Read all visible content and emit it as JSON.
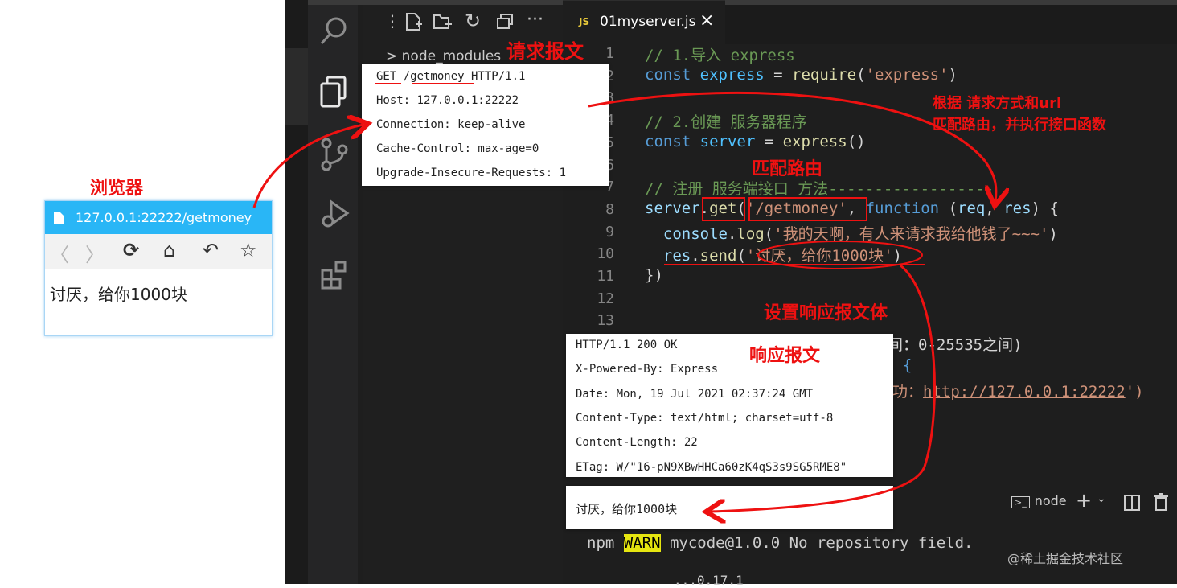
{
  "editor": {
    "tab_icon": "JS",
    "tab_filename": "01myserver.js",
    "tab_close": "×",
    "explorer_item": "> node_modules",
    "code_lines": [
      {
        "n": "1",
        "tokens": [
          [
            "cmt",
            "// 1.导入 express"
          ]
        ]
      },
      {
        "n": "2",
        "tokens": [
          [
            "kw",
            "const "
          ],
          [
            "var",
            "express"
          ],
          [
            "pl",
            " = "
          ],
          [
            "fn",
            "require"
          ],
          [
            "pl",
            "("
          ],
          [
            "str",
            "'express'"
          ],
          [
            "pl",
            ")"
          ]
        ]
      },
      {
        "n": "3",
        "tokens": []
      },
      {
        "n": "4",
        "tokens": [
          [
            "cmt",
            "// 2.创建 服务器程序"
          ]
        ]
      },
      {
        "n": "5",
        "tokens": [
          [
            "kw",
            "const "
          ],
          [
            "var",
            "server"
          ],
          [
            "pl",
            " = "
          ],
          [
            "fn",
            "express"
          ],
          [
            "pl",
            "()"
          ]
        ]
      },
      {
        "n": "6",
        "tokens": []
      },
      {
        "n": "7",
        "tokens": [
          [
            "cmt",
            "// 注册 服务端接口 方法------------------"
          ]
        ]
      },
      {
        "n": "8",
        "tokens": [
          [
            "par",
            "server"
          ],
          [
            "pl",
            "."
          ],
          [
            "fn",
            "get"
          ],
          [
            "pl",
            "("
          ],
          [
            "str",
            "'/getmoney'"
          ],
          [
            "pl",
            ", "
          ],
          [
            "kw",
            "function"
          ],
          [
            "pl",
            " ("
          ],
          [
            "par",
            "req"
          ],
          [
            "pl",
            ", "
          ],
          [
            "par",
            "res"
          ],
          [
            "pl",
            ") {"
          ]
        ]
      },
      {
        "n": "9",
        "tokens": [
          [
            "pl",
            "  "
          ],
          [
            "par",
            "console"
          ],
          [
            "pl",
            "."
          ],
          [
            "fn",
            "log"
          ],
          [
            "pl",
            "("
          ],
          [
            "str",
            "'我的天啊，有人来请求我给他钱了~~~'"
          ],
          [
            "pl",
            ")"
          ]
        ]
      },
      {
        "n": "10",
        "tokens": [
          [
            "pl",
            "  "
          ],
          [
            "par",
            "res"
          ],
          [
            "pl",
            "."
          ],
          [
            "fn",
            "send"
          ],
          [
            "pl",
            "("
          ],
          [
            "str",
            "'讨厌，给你1000块'"
          ],
          [
            "pl",
            ")"
          ]
        ]
      },
      {
        "n": "11",
        "tokens": [
          [
            "pl",
            "})"
          ]
        ]
      },
      {
        "n": "12",
        "tokens": []
      },
      {
        "n": "13",
        "tokens": []
      }
    ],
    "partial_line_14": "间：0-25535之间)",
    "partial_line_15": "> {",
    "partial_line_16_prefix": "功：",
    "partial_line_16_url": "http://127.0.0.1:22222",
    "partial_line_16_suffix": "')",
    "terminal_tab": "node",
    "terminal_text_prefix": "npm ",
    "terminal_warn": "WARN",
    "terminal_text_suffix": " mycode@1.0.0 No repository field.",
    "terminal_next": "...0.17.1"
  },
  "request": {
    "title": "请求报文",
    "lines": [
      "GET /getmoney HTTP/1.1",
      "Host: 127.0.0.1:22222",
      "Connection: keep-alive",
      "Cache-Control: max-age=0",
      "Upgrade-Insecure-Requests: 1"
    ]
  },
  "response": {
    "title": "响应报文",
    "lines": [
      "HTTP/1.1 200 OK",
      "X-Powered-By: Express",
      "Date: Mon, 19 Jul 2021 02:37:24 GMT",
      "Content-Type: text/html; charset=utf-8",
      "Content-Length: 22",
      "ETag: W/\"16-pN9XBwHHCa60zK4qS3s9SG5RME8\""
    ],
    "body": "讨厌，给你1000块"
  },
  "annotations": {
    "browser": "浏览器",
    "match_route": "匹配路由",
    "route_note_1": "根据 请求方式和url",
    "route_note_2": "匹配路由，并执行接口函数",
    "set_body": "设置响应报文体"
  },
  "browser": {
    "url": "127.0.0.1:22222/getmoney",
    "content": "讨厌，给你1000块"
  },
  "watermark": "@稀土掘金技术社区",
  "colors": {
    "annotation_red": "#ee1111",
    "browser_bar": "#29b6f6",
    "editor_bg": "#1e1e1e"
  }
}
